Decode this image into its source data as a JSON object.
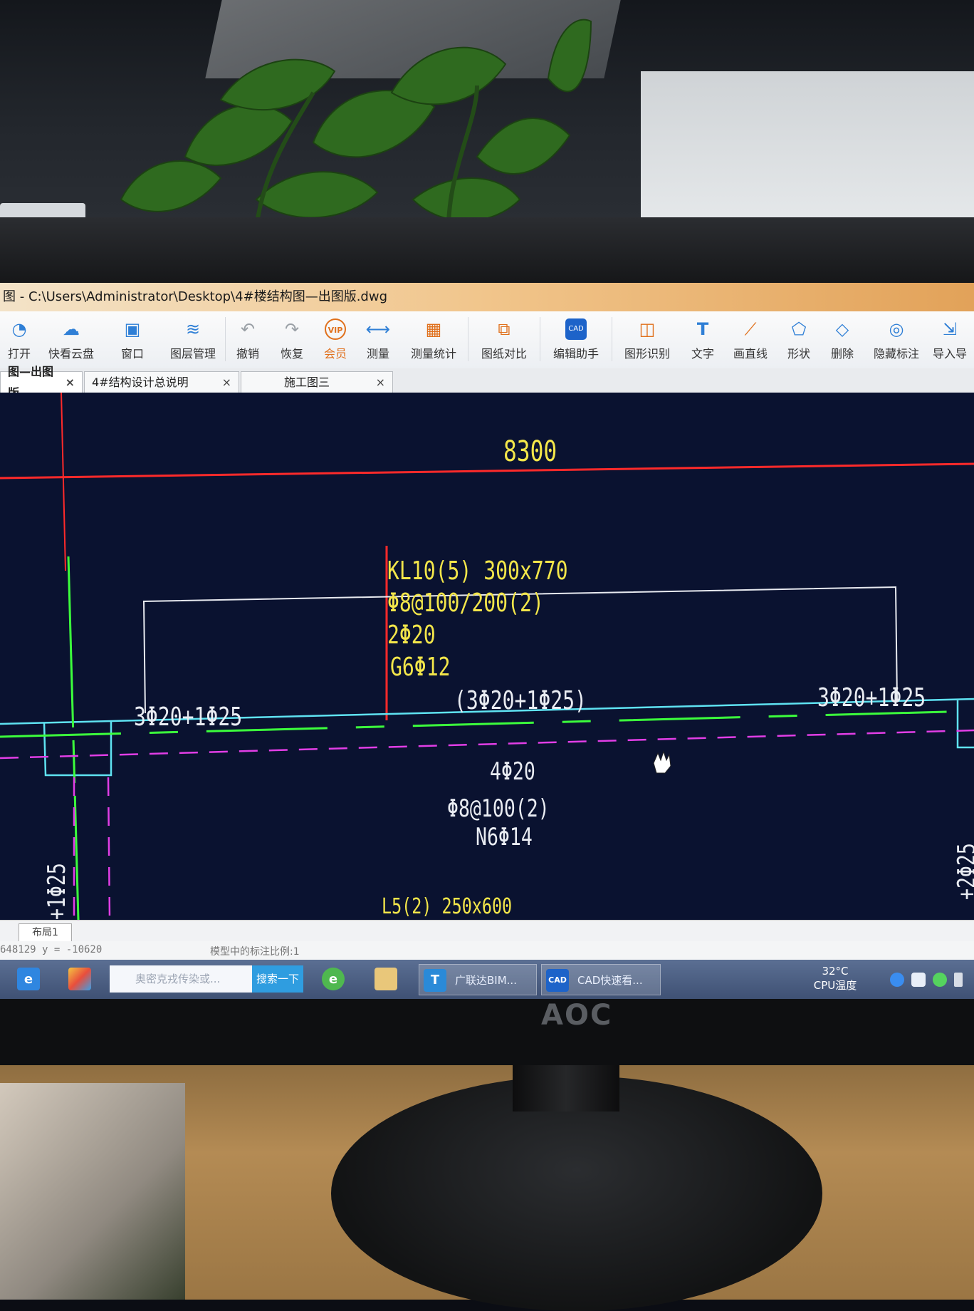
{
  "window": {
    "title": "图 - C:\\Users\\Administrator\\Desktop\\4#楼结构图—出图版.dwg"
  },
  "toolbar": {
    "items": [
      {
        "label": "打开",
        "icon": "open-icon"
      },
      {
        "label": "快看云盘",
        "icon": "cloud-icon"
      },
      {
        "label": "窗口",
        "icon": "window-icon"
      },
      {
        "label": "图层管理",
        "icon": "layers-icon"
      },
      {
        "label": "撤销",
        "icon": "undo-icon"
      },
      {
        "label": "恢复",
        "icon": "redo-icon"
      },
      {
        "label": "会员",
        "icon": "vip-icon",
        "badge": "VIP"
      },
      {
        "label": "测量",
        "icon": "measure-icon"
      },
      {
        "label": "测量统计",
        "icon": "measure-stats-icon"
      },
      {
        "label": "图纸对比",
        "icon": "compare-icon"
      },
      {
        "label": "编辑助手",
        "icon": "edit-helper-icon"
      },
      {
        "label": "图形识别",
        "icon": "shape-recognize-icon"
      },
      {
        "label": "文字",
        "icon": "text-icon"
      },
      {
        "label": "画直线",
        "icon": "line-icon"
      },
      {
        "label": "形状",
        "icon": "shape-icon"
      },
      {
        "label": "删除",
        "icon": "eraser-icon"
      },
      {
        "label": "隐藏标注",
        "icon": "hide-annotation-icon"
      },
      {
        "label": "导入导",
        "icon": "import-icon"
      }
    ]
  },
  "tabs": [
    {
      "label": "图—出图版",
      "active": true
    },
    {
      "label": "4#结构设计总说明",
      "active": false
    },
    {
      "label": "施工图三",
      "active": false
    }
  ],
  "drawing": {
    "dimension": "8300",
    "beam_label": "KL10(5) 300x770",
    "stirrup": "Φ8@100/200(2)",
    "top_bars": "2Φ20",
    "side_bars": "G6Φ12",
    "left_support": "3Φ20+1Φ25",
    "mid_support": "(3Φ20+1Φ25)",
    "right_support": "3Φ20+1Φ25",
    "bottom_bars": "4Φ20",
    "bottom_stirrup": "Φ8@100(2)",
    "bottom_side": "N6Φ14",
    "vertical_left": "+1Φ25",
    "vertical_right": "+2Φ25",
    "cut_label": "L5(2) 250x600"
  },
  "bottom": {
    "layout_tab": "布局1",
    "coords": "648129 y = -10620",
    "scale": "模型中的标注比例:1"
  },
  "taskbar": {
    "search_placeholder": "奥密克戎传染或...",
    "search_button": "搜索一下",
    "apps": [
      {
        "label": "广联达BIM...",
        "icon_text": "T"
      },
      {
        "label": "CAD快速看...",
        "icon_text": "CAD"
      }
    ],
    "temp_value": "32°C",
    "temp_label": "CPU温度"
  },
  "monitor": {
    "brand": "AOC"
  },
  "colors": {
    "canvas_bg": "#0a1230",
    "cad_yellow": "#f3e64a",
    "axis_red": "#ff2a2a",
    "beam_cyan": "#5fe3f2",
    "rebar_green": "#3cff3c",
    "dashed_magenta": "#e23ee6"
  }
}
